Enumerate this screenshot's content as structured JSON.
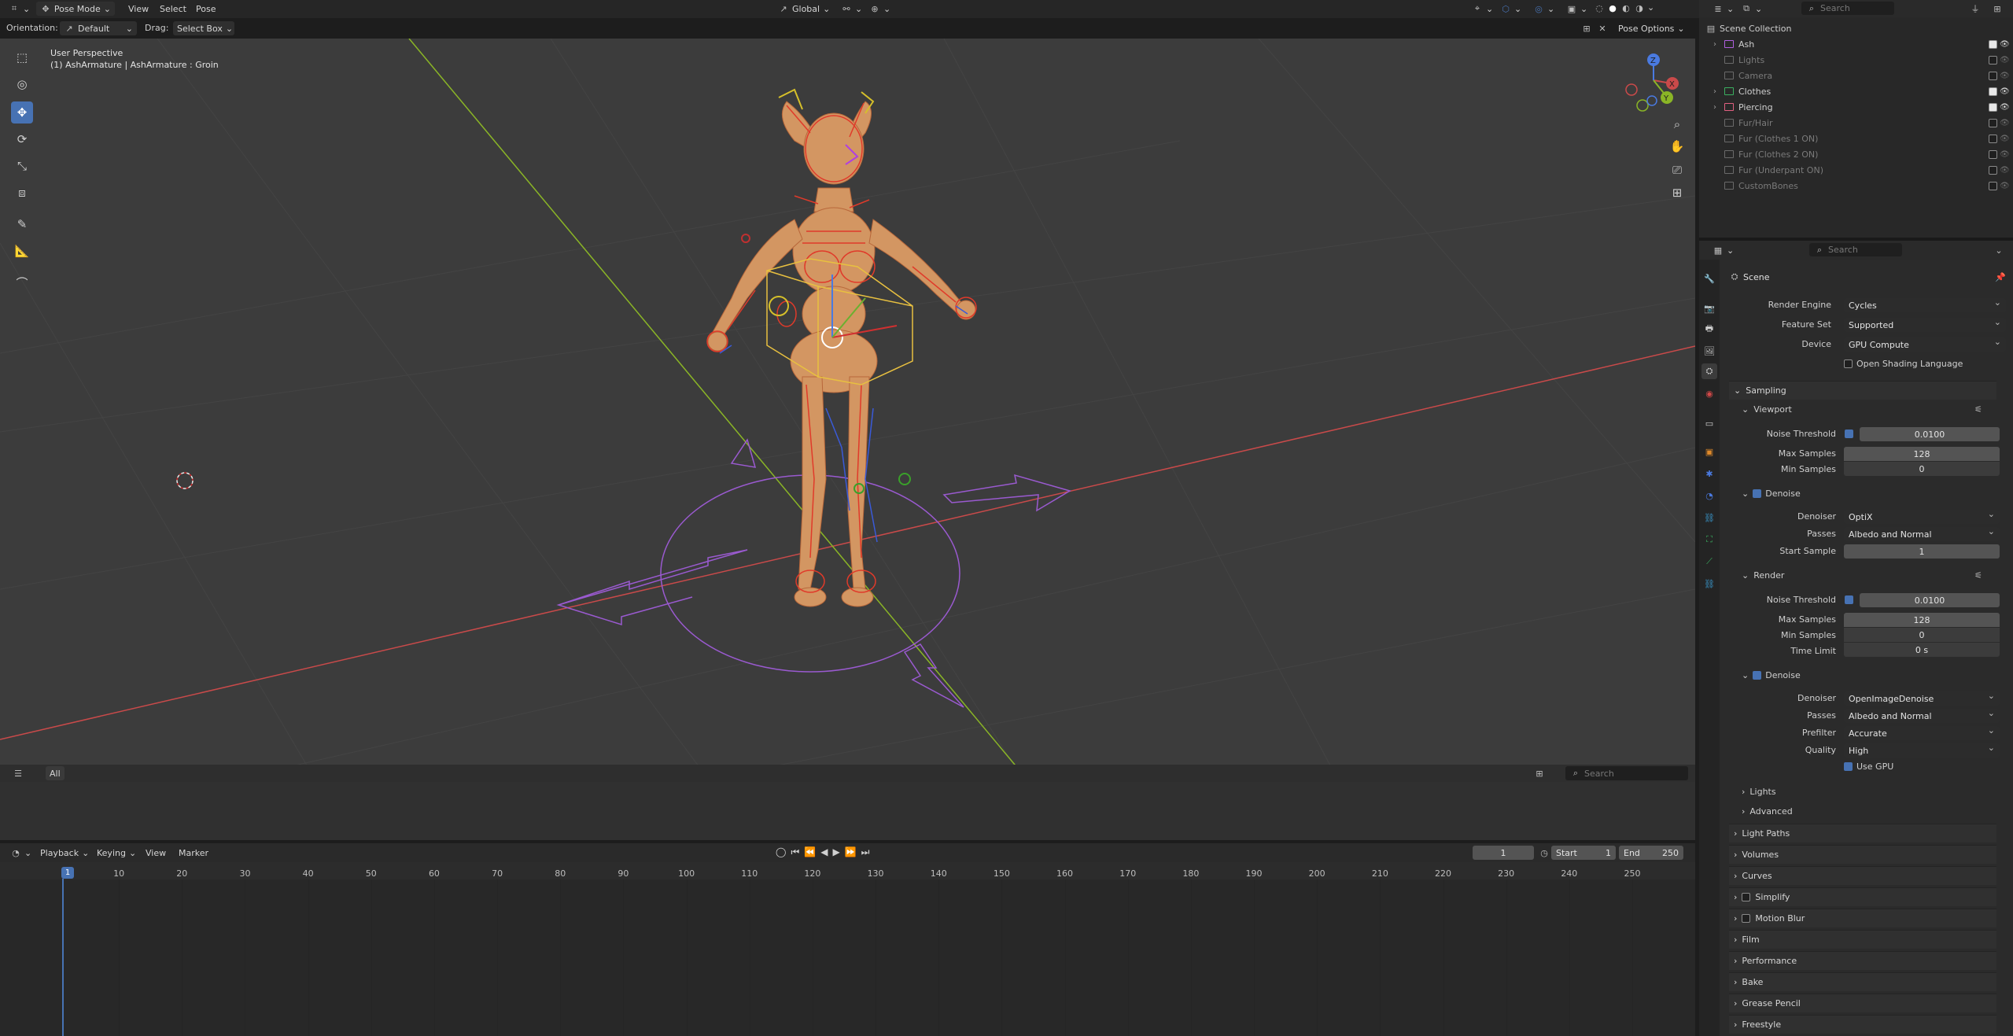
{
  "viewport_header": {
    "mode": "Pose Mode",
    "menus": [
      "View",
      "Select",
      "Pose"
    ],
    "orientation_label": "Global",
    "pose_options": "Pose Options"
  },
  "tool_settings": {
    "orientation_label": "Orientation:",
    "orientation_value": "Default",
    "drag_label": "Drag:",
    "drag_value": "Select Box"
  },
  "viewport": {
    "view_name": "User Perspective",
    "object_info": "(1) AshArmature | AshArmature : Groin",
    "gizmo": {
      "x": "X",
      "y": "Y",
      "z": "Z"
    }
  },
  "asset_bar": {
    "filter": "All",
    "search_placeholder": "Search"
  },
  "outliner": {
    "search_placeholder": "Search",
    "root": "Scene Collection",
    "items": [
      {
        "name": "Ash",
        "dim": false,
        "checked": true
      },
      {
        "name": "Lights",
        "dim": true,
        "checked": false
      },
      {
        "name": "Camera",
        "dim": true,
        "checked": false
      },
      {
        "name": "Clothes",
        "dim": false,
        "checked": true
      },
      {
        "name": "Piercing",
        "dim": false,
        "checked": true
      },
      {
        "name": "Fur/Hair",
        "dim": true,
        "checked": false
      },
      {
        "name": "Fur (Clothes 1 ON)",
        "dim": true,
        "checked": false
      },
      {
        "name": "Fur (Clothes 2 ON)",
        "dim": true,
        "checked": false
      },
      {
        "name": "Fur (Underpant ON)",
        "dim": true,
        "checked": false
      },
      {
        "name": "CustomBones",
        "dim": true,
        "checked": false
      }
    ]
  },
  "properties": {
    "search_placeholder": "Search",
    "context": "Scene",
    "render_engine_label": "Render Engine",
    "render_engine": "Cycles",
    "feature_set_label": "Feature Set",
    "feature_set": "Supported",
    "device_label": "Device",
    "device": "GPU Compute",
    "osl_label": "Open Shading Language",
    "sampling": "Sampling",
    "viewport": "Viewport",
    "vp_noise_label": "Noise Threshold",
    "vp_noise": "0.0100",
    "vp_max_label": "Max Samples",
    "vp_max": "128",
    "vp_min_label": "Min Samples",
    "vp_min": "0",
    "vp_denoise": "Denoise",
    "vp_denoiser_label": "Denoiser",
    "vp_denoiser": "OptiX",
    "vp_passes_label": "Passes",
    "vp_passes": "Albedo and Normal",
    "vp_start_label": "Start Sample",
    "vp_start": "1",
    "render": "Render",
    "r_noise_label": "Noise Threshold",
    "r_noise": "0.0100",
    "r_max_label": "Max Samples",
    "r_max": "128",
    "r_min_label": "Min Samples",
    "r_min": "0",
    "r_time_label": "Time Limit",
    "r_time": "0 s",
    "r_denoise": "Denoise",
    "r_denoiser_label": "Denoiser",
    "r_denoiser": "OpenImageDenoise",
    "r_passes_label": "Passes",
    "r_passes": "Albedo and Normal",
    "r_prefilter_label": "Prefilter",
    "r_prefilter": "Accurate",
    "r_quality_label": "Quality",
    "r_quality": "High",
    "r_use_gpu": "Use GPU",
    "sub_lights": "Lights",
    "sub_advanced": "Advanced",
    "sections": [
      "Light Paths",
      "Volumes",
      "Curves",
      "Simplify",
      "Motion Blur",
      "Film",
      "Performance",
      "Bake",
      "Grease Pencil",
      "Freestyle"
    ]
  },
  "timeline": {
    "menus": [
      "Playback",
      "Keying",
      "View",
      "Marker"
    ],
    "current_frame": "1",
    "start_label": "Start",
    "start": "1",
    "end_label": "End",
    "end": "250",
    "ticks": [
      "1",
      "10",
      "20",
      "30",
      "40",
      "50",
      "60",
      "70",
      "80",
      "90",
      "100",
      "110",
      "120",
      "130",
      "140",
      "150",
      "160",
      "170",
      "180",
      "190",
      "200",
      "210",
      "220",
      "230",
      "240",
      "250"
    ]
  },
  "colors": {
    "accent": "#4772b3",
    "x_axis": "#c94a4a",
    "y_axis": "#8ab526",
    "armature": "#e03a2a",
    "character": "#d39662"
  }
}
